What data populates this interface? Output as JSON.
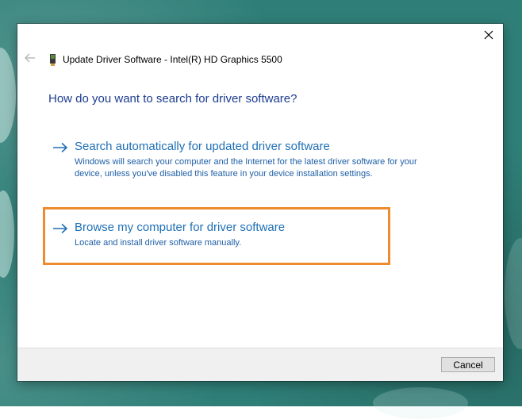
{
  "window": {
    "title": "Update Driver Software - Intel(R) HD Graphics 5500"
  },
  "icons": {
    "close": "close-icon",
    "back": "back-arrow-icon",
    "device": "graphics-card-icon",
    "option_arrow": "right-arrow-icon"
  },
  "main": {
    "question": "How do you want to search for driver software?",
    "options": [
      {
        "title": "Search automatically for updated driver software",
        "description": "Windows will search your computer and the Internet for the latest driver software for your device, unless you've disabled this feature in your device installation settings."
      },
      {
        "title": "Browse my computer for driver software",
        "description": "Locate and install driver software manually."
      }
    ]
  },
  "footer": {
    "cancel_label": "Cancel"
  },
  "colors": {
    "question_text": "#1c3c8f",
    "link_text": "#1e6fb5",
    "highlight_border": "#ef8b2f",
    "desktop_background": "#2f7f78"
  }
}
